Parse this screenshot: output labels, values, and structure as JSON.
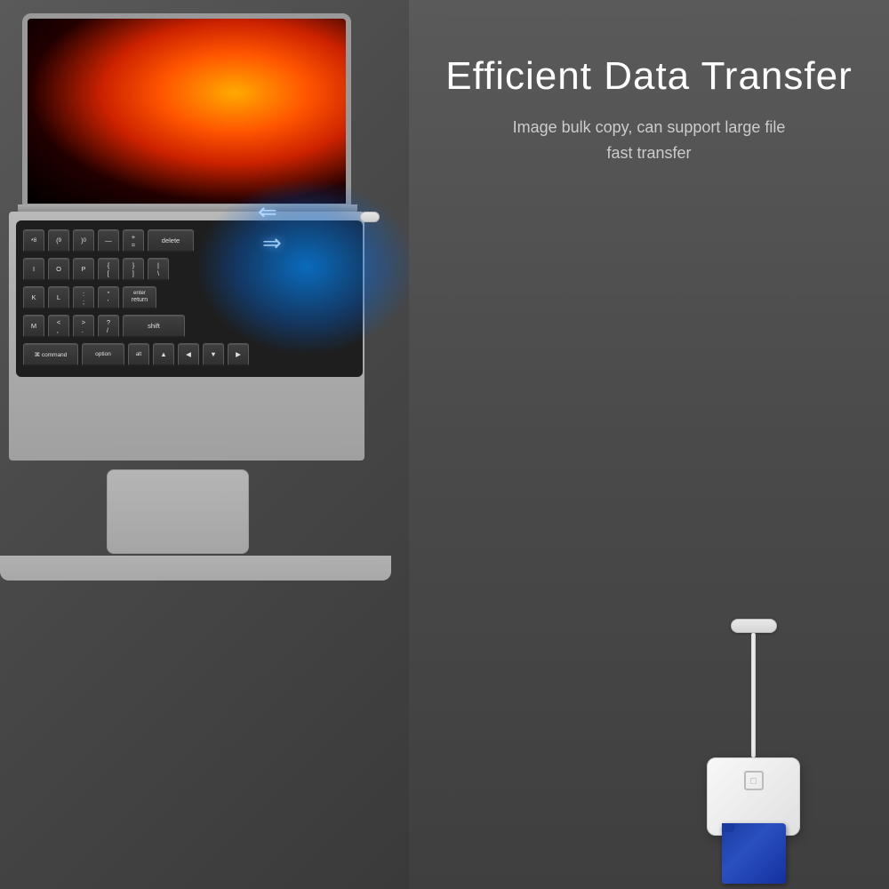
{
  "page": {
    "background_left": "#5a5a5a",
    "background_right": "#4a4a4a"
  },
  "header": {
    "title": "Efficient Data Transfer",
    "subtitle_line1": "Image bulk copy, can support large file",
    "subtitle_line2": "fast transfer"
  },
  "keyboard": {
    "rows": [
      [
        "8",
        "9",
        "0",
        "-",
        "=",
        "delete"
      ],
      [
        "I",
        "O",
        "P",
        "[",
        "]",
        "\\"
      ],
      [
        "K",
        "L",
        ";",
        "'",
        "enter",
        "return"
      ],
      [
        "M",
        "<",
        ">",
        "/",
        "shift"
      ],
      [
        "⌘ command",
        "option",
        "alt",
        "▲",
        "◀",
        "▼",
        "▶"
      ]
    ]
  },
  "device": {
    "cable_color": "#f0f0f0",
    "reader_color": "#ececec",
    "card_color": "#1a3a8f",
    "logo": "◻"
  }
}
